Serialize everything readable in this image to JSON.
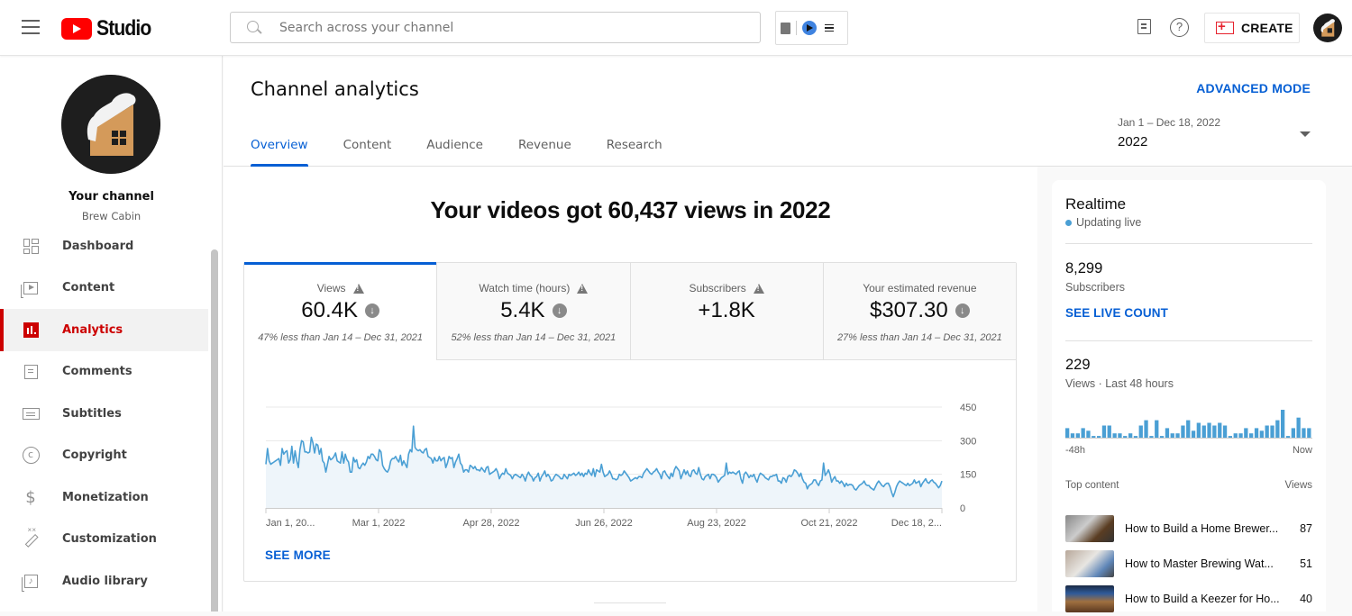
{
  "app": {
    "logo_text": "Studio",
    "search_placeholder": "Search across your channel",
    "create_label": "CREATE",
    "help_glyph": "?"
  },
  "icons": {
    "menu": "hamburger-icon",
    "search": "search-icon",
    "feedback": "feedback-icon",
    "help": "help-icon",
    "create": "video-plus-icon"
  },
  "sidebar": {
    "channel_title": "Your channel",
    "channel_name": "Brew Cabin",
    "items": [
      {
        "label": "Dashboard",
        "icon": "dashboard-icon",
        "active": false
      },
      {
        "label": "Content",
        "icon": "content-icon",
        "active": false
      },
      {
        "label": "Analytics",
        "icon": "analytics-icon",
        "active": true
      },
      {
        "label": "Comments",
        "icon": "comments-icon",
        "active": false
      },
      {
        "label": "Subtitles",
        "icon": "subtitles-icon",
        "active": false
      },
      {
        "label": "Copyright",
        "icon": "copyright-icon",
        "active": false
      },
      {
        "label": "Monetization",
        "icon": "monetization-icon",
        "active": false
      },
      {
        "label": "Customization",
        "icon": "customization-icon",
        "active": false
      },
      {
        "label": "Audio library",
        "icon": "audio-library-icon",
        "active": false
      }
    ],
    "copyright_glyph": "c",
    "money_glyph": "$",
    "audio_glyph": "♪"
  },
  "header": {
    "title": "Channel analytics",
    "advanced_mode": "ADVANCED MODE",
    "tabs": [
      {
        "label": "Overview",
        "active": true
      },
      {
        "label": "Content",
        "active": false
      },
      {
        "label": "Audience",
        "active": false
      },
      {
        "label": "Revenue",
        "active": false
      },
      {
        "label": "Research",
        "active": false
      }
    ],
    "date_range": "Jan 1 – Dec 18, 2022",
    "date_value": "2022"
  },
  "overview": {
    "headline": "Your videos got 60,437 views in 2022",
    "metrics": [
      {
        "label": "Views",
        "value": "60.4K",
        "warning": true,
        "trend": "down",
        "compare": "47% less than Jan 14 – Dec 31, 2021",
        "active": true
      },
      {
        "label": "Watch time (hours)",
        "value": "5.4K",
        "warning": true,
        "trend": "down",
        "compare": "52% less than Jan 14 – Dec 31, 2021",
        "active": false
      },
      {
        "label": "Subscribers",
        "value": "+1.8K",
        "warning": true,
        "trend": "",
        "compare": "",
        "active": false
      },
      {
        "label": "Your estimated revenue",
        "value": "$307.30",
        "warning": false,
        "trend": "down",
        "compare": "27% less than Jan 14 – Dec 31, 2021",
        "active": false
      }
    ],
    "down_glyph": "↓",
    "see_more": "SEE MORE"
  },
  "chart_data": {
    "type": "area",
    "title": "",
    "xlabel": "",
    "ylabel": "Views",
    "ylim": [
      0,
      450
    ],
    "yticks": [
      0,
      150,
      300,
      450
    ],
    "ytick_labels": [
      "0",
      "150",
      "300",
      "450"
    ],
    "xtick_labels": [
      "Jan 1, 20...",
      "Mar 1, 2022",
      "Apr 28, 2022",
      "Jun 26, 2022",
      "Aug 23, 2022",
      "Oct 21, 2022",
      "Dec 18, 2..."
    ],
    "x_start": "2022-01-01",
    "x_end": "2022-12-18",
    "grid": true,
    "color": "#4a9fd4",
    "series": [
      {
        "name": "Views",
        "values": [
          195,
          265,
          210,
          195,
          200,
          205,
          210,
          215,
          220,
          190,
          265,
          240,
          250,
          255,
          200,
          215,
          275,
          200,
          255,
          210,
          180,
          260,
          300,
          295,
          250,
          250,
          245,
          250,
          315,
          290,
          245,
          285,
          280,
          240,
          265,
          210,
          200,
          160,
          195,
          230,
          215,
          220,
          230,
          245,
          210,
          205,
          200,
          250,
          200,
          240,
          215,
          205,
          160,
          160,
          225,
          205,
          215,
          180,
          175,
          190,
          200,
          190,
          205,
          230,
          220,
          240,
          240,
          230,
          215,
          210,
          260,
          250,
          190,
          175,
          165,
          160,
          175,
          210,
          220,
          220,
          230,
          215,
          205,
          235,
          190,
          210,
          195,
          180,
          240,
          260,
          250,
          365,
          270,
          260,
          255,
          260,
          250,
          245,
          260,
          265,
          230,
          225,
          220,
          200,
          225,
          210,
          210,
          230,
          210,
          220,
          225,
          180,
          200,
          230,
          220,
          225,
          180,
          205,
          220,
          240,
          200,
          190,
          160,
          170,
          170,
          160,
          190,
          185,
          175,
          185,
          170,
          170,
          165,
          180,
          170,
          160,
          180,
          185,
          150,
          155,
          160,
          165,
          175,
          160,
          130,
          145,
          155,
          150,
          175,
          155,
          150,
          145,
          130,
          145,
          150,
          145,
          140,
          135,
          150,
          140,
          120,
          145,
          160,
          145,
          140,
          120,
          135,
          140,
          155,
          120,
          140,
          150,
          165,
          140,
          150,
          140,
          120,
          125,
          140,
          150,
          145,
          140,
          130,
          130,
          150,
          140,
          130,
          150,
          145,
          150,
          155,
          145,
          150,
          160,
          145,
          155,
          140,
          155,
          150,
          170,
          155,
          145,
          175,
          140,
          170,
          165,
          160,
          195,
          160,
          140,
          145,
          150,
          165,
          150,
          130,
          130,
          125,
          130,
          150,
          145,
          150,
          165,
          155,
          145,
          135,
          120,
          125,
          130,
          135,
          130,
          140,
          140,
          135,
          155,
          165,
          175,
          165,
          155,
          150,
          160,
          165,
          175,
          160,
          150,
          130,
          160,
          165,
          150,
          140,
          130,
          155,
          140,
          170,
          185,
          175,
          165,
          130,
          150,
          170,
          150,
          165,
          145,
          140,
          165,
          170,
          155,
          150,
          180,
          150,
          130,
          125,
          140,
          145,
          150,
          130,
          150,
          150,
          145,
          135,
          115,
          125,
          135,
          140,
          145,
          200,
          150,
          160,
          155,
          160,
          155,
          150,
          160,
          165,
          130,
          110,
          150,
          160,
          150,
          135,
          145,
          140,
          150,
          130,
          115,
          140,
          155,
          150,
          145,
          135,
          130,
          125,
          140,
          140,
          145,
          145,
          150,
          120,
          120,
          110,
          135,
          130,
          115,
          140,
          145,
          140,
          150,
          170,
          165,
          155,
          140,
          155,
          130,
          115,
          110,
          85,
          100,
          105,
          110,
          125,
          125,
          110,
          100,
          120,
          125,
          200,
          145,
          155,
          170,
          150,
          115,
          130,
          140,
          120,
          120,
          110,
          120,
          110,
          95,
          110,
          100,
          105,
          105,
          100,
          85,
          80,
          90,
          100,
          105,
          110,
          120,
          105,
          100,
          100,
          90,
          85,
          80,
          95,
          110,
          120,
          110,
          100,
          95,
          105,
          110,
          110,
          95,
          70,
          50,
          70,
          95,
          110,
          120,
          115,
          110,
          105,
          100,
          110,
          100,
          105,
          110,
          125,
          110,
          115,
          120,
          95,
          110,
          120,
          130,
          115,
          110,
          120,
          125,
          115,
          110,
          100,
          90,
          100,
          120
        ]
      }
    ]
  },
  "realtime": {
    "title": "Realtime",
    "status": "Updating live",
    "subscribers_value": "8,299",
    "subscribers_label": "Subscribers",
    "see_live_count": "SEE LIVE COUNT",
    "views_value": "229",
    "views_label": "Views · Last 48 hours",
    "axis_left": "-48h",
    "axis_right": "Now",
    "hourly_views": [
      4,
      2,
      2,
      4,
      3,
      1,
      1,
      5,
      5,
      2,
      2,
      1,
      2,
      1,
      5,
      7,
      1,
      7,
      1,
      4,
      2,
      2,
      5,
      7,
      3,
      6,
      5,
      6,
      5,
      6,
      5,
      1,
      2,
      2,
      4,
      2,
      4,
      3,
      5,
      5,
      7,
      11,
      1,
      4,
      8,
      4,
      4
    ],
    "bar_color": "#4a9fd4",
    "top_content_label": "Top content",
    "top_content_views_label": "Views",
    "top_content": [
      {
        "title": "How to Build a Home Brewer...",
        "views": "87"
      },
      {
        "title": "How to Master Brewing Wat...",
        "views": "51"
      },
      {
        "title": "How to Build a Keezer for Ho...",
        "views": "40"
      }
    ]
  },
  "colors": {
    "accent_blue": "#065fd4",
    "brand_red": "#ff0000",
    "active_red": "#cc0000",
    "chart_line": "#4a9fd4"
  }
}
